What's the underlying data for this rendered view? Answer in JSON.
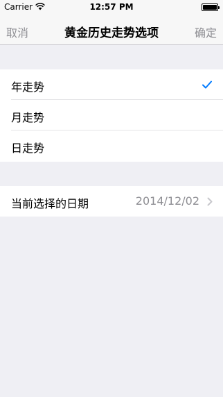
{
  "status_bar": {
    "carrier": "Carrier",
    "time": "12:57 PM",
    "icons": [
      "wifi-icon",
      "battery-icon"
    ]
  },
  "nav": {
    "left": "取消",
    "title": "黄金历史走势选项",
    "right": "确定"
  },
  "trend_options": [
    {
      "label": "年走势",
      "selected": true
    },
    {
      "label": "月走势",
      "selected": false
    },
    {
      "label": "日走势",
      "selected": false
    }
  ],
  "date_row": {
    "label": "当前选择的日期",
    "value": "2014/12/02"
  },
  "colors": {
    "accent": "#007aff",
    "background": "#efeff4",
    "secondary_text": "#8e8e93"
  }
}
